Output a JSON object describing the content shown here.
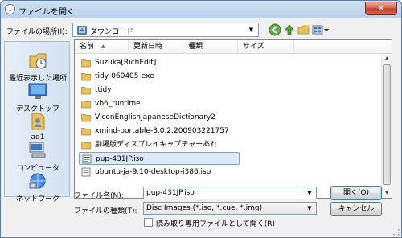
{
  "window": {
    "title": "ファイルを開く",
    "close_glyph": "✕"
  },
  "lookin": {
    "label": "ファイルの場所(I):",
    "value": "ダウンロード"
  },
  "places": [
    {
      "label": "最近表示した場所",
      "icon": "recent-places-icon"
    },
    {
      "label": "デスクトップ",
      "icon": "desktop-icon"
    },
    {
      "label": "ad1",
      "icon": "user-folder-icon"
    },
    {
      "label": "コンピュータ",
      "icon": "computer-icon"
    },
    {
      "label": "ネットワーク",
      "icon": "network-icon"
    }
  ],
  "columns": [
    "名前",
    "更新日時",
    "種類",
    "サイズ"
  ],
  "files": [
    {
      "name": "Suzuka[RichEdit]",
      "type": "folder"
    },
    {
      "name": "tidy-060405-exe",
      "type": "folder"
    },
    {
      "name": "ttidy",
      "type": "folder"
    },
    {
      "name": "vb6_runtime",
      "type": "folder"
    },
    {
      "name": "ViconEnglishJapaneseDictionary2",
      "type": "folder"
    },
    {
      "name": "xmind-portable-3.0.2.200903221757",
      "type": "folder"
    },
    {
      "name": "劇場版ディスプレイキャプチャーあれ",
      "type": "folder"
    },
    {
      "name": "pup-431JP.iso",
      "type": "iso",
      "selected": true
    },
    {
      "name": "ubuntu-ja-9.10-desktop-i386.iso",
      "type": "iso"
    }
  ],
  "filename": {
    "label": "ファイル名(N):",
    "value": "pup-431JP.iso"
  },
  "filetype": {
    "label": "ファイルの種類(T):",
    "value": "Disc Images (*.iso, *.cue, *.img)"
  },
  "readonly": {
    "label": "読み取り専用ファイルとして開く(R)"
  },
  "buttons": {
    "open": "開く(O)",
    "cancel": "キャンセル"
  },
  "colors": {
    "folder": "#e8c15a",
    "selection": "#dce9f8",
    "accent": "#3c7fb1"
  }
}
